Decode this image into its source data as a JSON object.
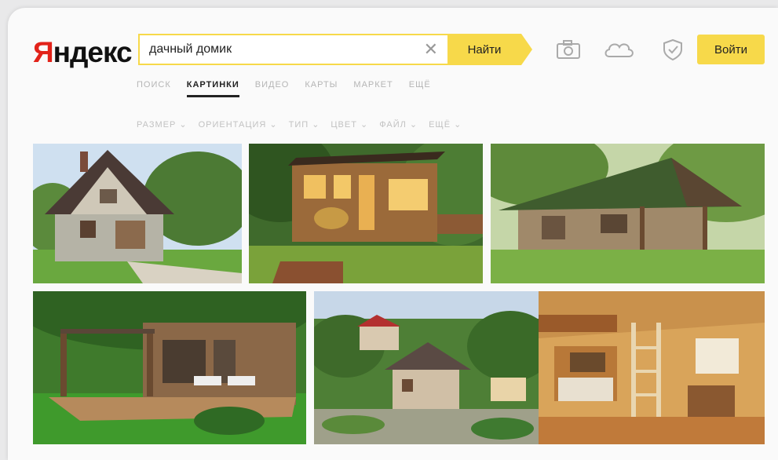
{
  "logo": {
    "first": "Я",
    "rest": "ндекс"
  },
  "search": {
    "value": "дачный домик",
    "find_label": "Найти"
  },
  "header": {
    "login_label": "Войти"
  },
  "nav": {
    "items": [
      {
        "label": "ПОИСК"
      },
      {
        "label": "КАРТИНКИ"
      },
      {
        "label": "ВИДЕО"
      },
      {
        "label": "КАРТЫ"
      },
      {
        "label": "МАРКЕТ"
      },
      {
        "label": "ЕЩЁ"
      }
    ]
  },
  "filters": {
    "items": [
      {
        "label": "РАЗМЕР ⌄"
      },
      {
        "label": "ОРИЕНТАЦИЯ ⌄"
      },
      {
        "label": "ТИП ⌄"
      },
      {
        "label": "ЦВЕТ ⌄"
      },
      {
        "label": "ФАЙЛ ⌄"
      },
      {
        "label": "ЕЩЁ ⌄"
      }
    ]
  },
  "icons": [
    "camera-icon",
    "cloud-icon",
    "shield-icon",
    "clear-icon"
  ],
  "colors": {
    "accent": "#f7d94a",
    "logo_red": "#e2231a"
  }
}
